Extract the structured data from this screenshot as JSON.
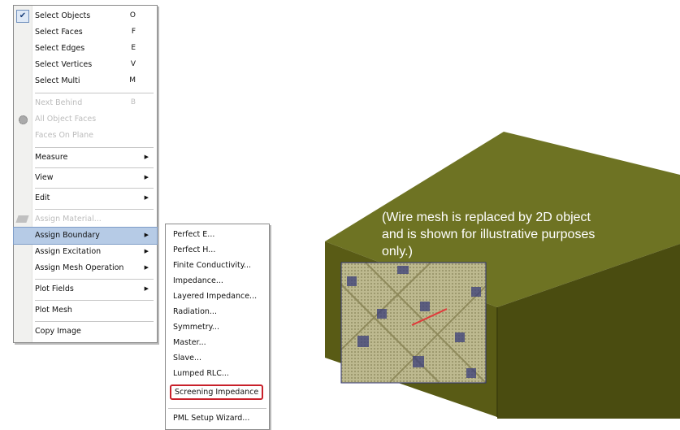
{
  "main_menu": {
    "items": [
      {
        "label": "Select Objects",
        "shortcut": "O",
        "checked": true
      },
      {
        "label": "Select Faces",
        "shortcut": "F"
      },
      {
        "label": "Select Edges",
        "shortcut": "E"
      },
      {
        "label": "Select Vertices",
        "shortcut": "V"
      },
      {
        "label": "Select Multi",
        "shortcut": "M"
      },
      {
        "label": "Next Behind",
        "shortcut": "B",
        "disabled": true
      },
      {
        "label": "All Object Faces",
        "disabled": true,
        "icon": "gear-icon"
      },
      {
        "label": "Faces On Plane",
        "disabled": true
      },
      {
        "label": "Measure",
        "submenu": true
      },
      {
        "label": "View",
        "submenu": true
      },
      {
        "label": "Edit",
        "submenu": true
      },
      {
        "label": "Assign Material...",
        "disabled": true,
        "icon": "material-icon"
      },
      {
        "label": "Assign Boundary",
        "submenu": true,
        "hover": true
      },
      {
        "label": "Assign Excitation",
        "submenu": true
      },
      {
        "label": "Assign Mesh Operation",
        "submenu": true
      },
      {
        "label": "Plot Fields",
        "submenu": true
      },
      {
        "label": "Plot Mesh"
      },
      {
        "label": "Copy Image"
      }
    ]
  },
  "submenu": {
    "items": [
      {
        "label": "Perfect E..."
      },
      {
        "label": "Perfect H..."
      },
      {
        "label": "Finite Conductivity..."
      },
      {
        "label": "Impedance..."
      },
      {
        "label": "Layered Impedance..."
      },
      {
        "label": "Radiation..."
      },
      {
        "label": "Symmetry..."
      },
      {
        "label": "Master..."
      },
      {
        "label": "Slave..."
      },
      {
        "label": "Lumped RLC..."
      },
      {
        "label": "Screening Impedance",
        "highlighted": true
      },
      {
        "label": "PML Setup Wizard..."
      }
    ]
  },
  "model": {
    "caption": "(Wire mesh is replaced by 2D object and is shown for illustrative purposes only.)",
    "colors": {
      "top": "#6e7323",
      "front": "#595b15",
      "side": "#4a4c10",
      "mesh": "#bdb98f",
      "mesh_dots": "#3b3f7a",
      "highlight_line": "#e03a3a",
      "menu_highlight": "#c8202a"
    }
  }
}
